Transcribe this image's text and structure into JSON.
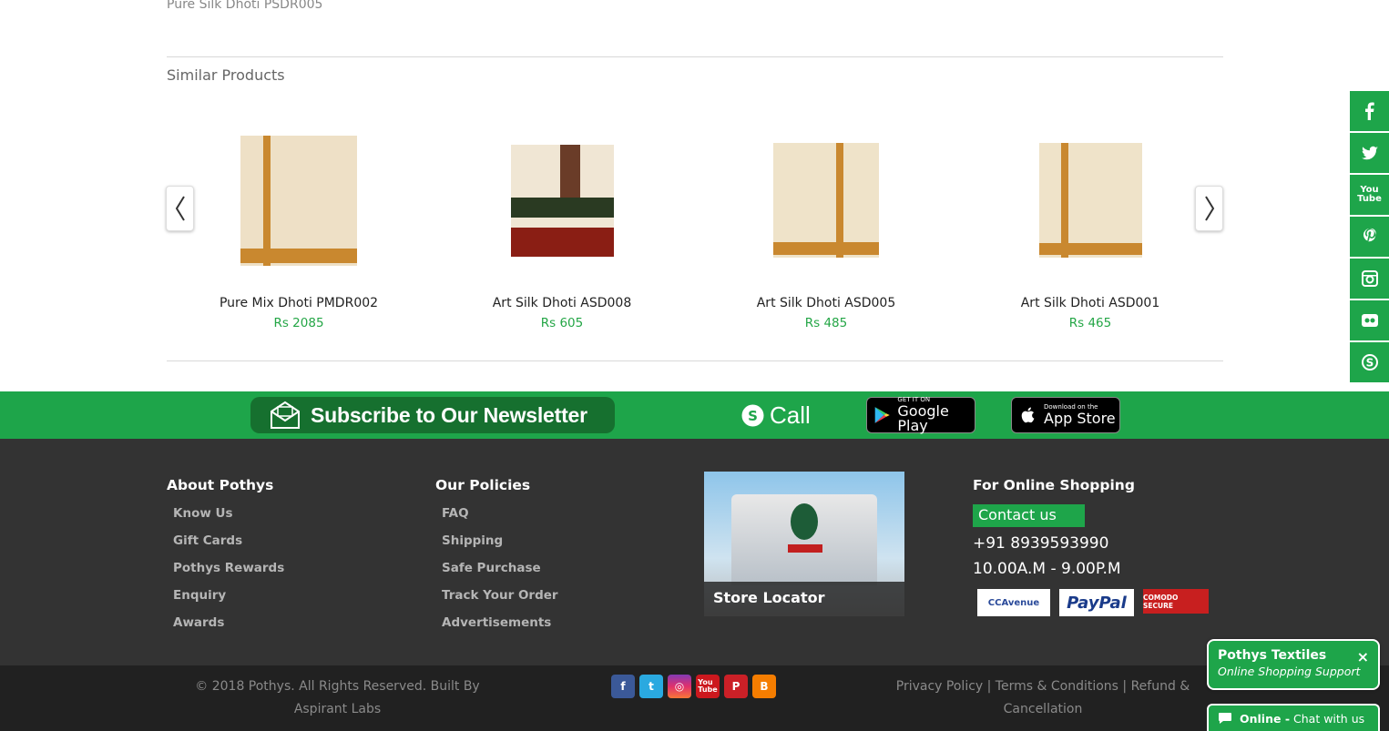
{
  "breadcrumb": {
    "current": "Pure Silk Dhoti PSDR005"
  },
  "similar": {
    "title": "Similar Products",
    "products": [
      {
        "name": "Pure Mix Dhoti PMDR002",
        "price": "Rs 2085"
      },
      {
        "name": "Art Silk Dhoti ASD008",
        "price": "Rs 605"
      },
      {
        "name": "Art Silk Dhoti ASD005",
        "price": "Rs 485"
      },
      {
        "name": "Art Silk Dhoti ASD001",
        "price": "Rs 465"
      }
    ]
  },
  "band": {
    "newsletter": "Subscribe to Our Newsletter",
    "call": "Call",
    "google_small": "GET IT ON",
    "google_big": "Google Play",
    "apple_small": "Download on the",
    "apple_big": "App Store"
  },
  "footer": {
    "about": {
      "title": "About Pothys",
      "links": [
        "Know Us",
        "Gift Cards",
        "Pothys Rewards",
        "Enquiry",
        "Awards"
      ]
    },
    "policies": {
      "title": "Our Policies",
      "links": [
        "FAQ",
        "Shipping",
        "Safe Purchase",
        "Track Your Order",
        "Advertisements"
      ]
    },
    "store_locator": "Store Locator",
    "online": {
      "title": "For Online Shopping",
      "contact": "Contact us",
      "phone": "+91 8939593990",
      "hours": "10.00A.M - 9.00P.M",
      "payments": [
        "CCAvenue",
        "PayPal",
        "COMODO SECURE"
      ]
    }
  },
  "bottom": {
    "copyright": "© 2018 Pothys. All Rights Reserved. Built By Aspirant Labs",
    "legal": "Privacy Policy | Terms & Conditions | Refund & Cancellation"
  },
  "chat": {
    "title": "Pothys Textiles",
    "subtitle": "Online Shopping Support",
    "status": "Online -",
    "cta": "Chat with us",
    "close": "×"
  },
  "colors": {
    "brand_green": "#1ea54a",
    "footer_dark": "#333333",
    "price_green": "#24a646"
  }
}
